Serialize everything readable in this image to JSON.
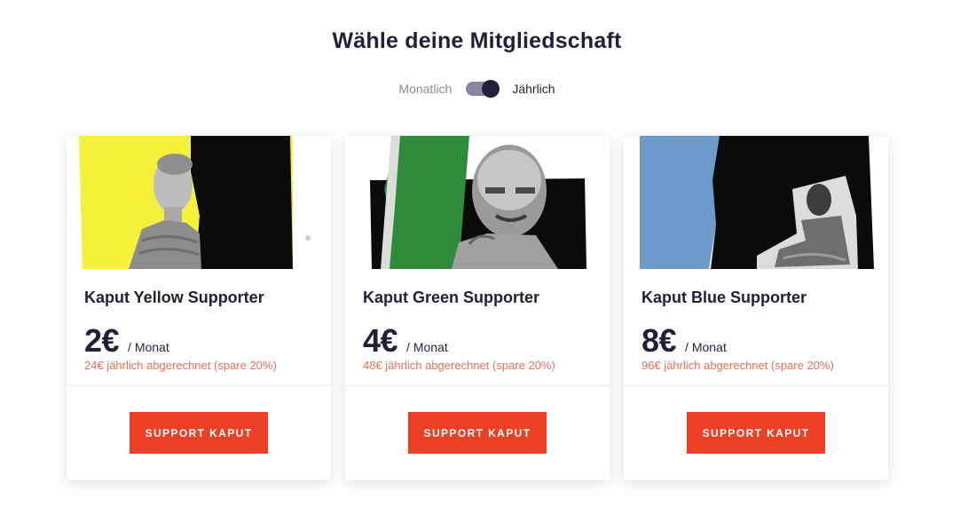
{
  "page": {
    "title": "Wähle deine Mitgliedschaft"
  },
  "billing_toggle": {
    "left_label": "Monatlich",
    "right_label": "Jährlich",
    "selected": "Jährlich"
  },
  "plans": [
    {
      "name": "Kaput Yellow Supporter",
      "price": "2€",
      "period": "/ Monat",
      "billing_note": "24€ jährlich abgerechnet (spare 20%)",
      "cta": "SUPPORT KAPUT",
      "accent_color": "#f5f13b"
    },
    {
      "name": "Kaput Green Supporter",
      "price": "4€",
      "period": "/ Monat",
      "billing_note": "48€ jährlich abgerechnet (spare 20%)",
      "cta": "SUPPORT KAPUT",
      "accent_color": "#2e8b3a"
    },
    {
      "name": "Kaput Blue Supporter",
      "price": "8€",
      "period": "/ Monat",
      "billing_note": "96€ jährlich abgerechnet (spare 20%)",
      "cta": "SUPPORT KAPUT",
      "accent_color": "#6d9bc9"
    }
  ],
  "colors": {
    "cta_background": "#ec4025",
    "billing_note": "#e9715b",
    "text": "#221f38"
  }
}
